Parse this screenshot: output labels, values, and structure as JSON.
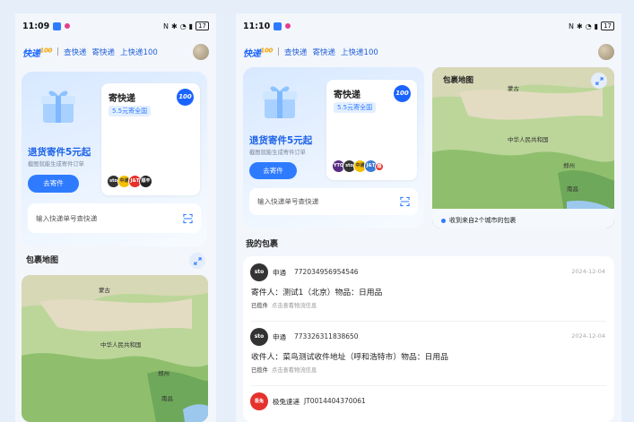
{
  "status": {
    "time_left": "11:09",
    "time_right": "11:10",
    "battery": "17"
  },
  "app": {
    "logo": "快递",
    "logo_num": "100",
    "nav": [
      "查快递",
      "寄快递",
      "上快递100"
    ]
  },
  "promo": {
    "title": "退货寄件5元起",
    "subtitle": "截图就能生成寄件订单",
    "button": "去寄件"
  },
  "ship": {
    "title": "寄快递",
    "price": "5.5元寄全国",
    "badge": "100"
  },
  "carriers_left": [
    "sto",
    "中通",
    "J&T",
    "顺丰"
  ],
  "carriers_right": [
    "YTO",
    "sto",
    "中通",
    "J&T",
    "顺"
  ],
  "search": {
    "placeholder": "输入快递单号查快递"
  },
  "map": {
    "title": "包裹地图",
    "labels": [
      "蒙古",
      "中华人民共和国",
      "郑州",
      "南昌"
    ],
    "tag": "收到来自2个城市的包裹"
  },
  "my_packages": {
    "title": "我的包裹",
    "items": [
      {
        "logo": "sto",
        "carrier": "申通",
        "num": "772034956954546",
        "date": "2024-12-04",
        "desc": "寄件人：测试1（北京）物品：日用品",
        "status": "已揽件",
        "hint": "点击查看物流信息"
      },
      {
        "logo": "sto",
        "carrier": "申通",
        "num": "773326311838650",
        "date": "2024-12-04",
        "desc": "收件人：菜鸟测试收件地址（呼和浩特市）物品：日用品",
        "status": "已揽件",
        "hint": "点击查看物流信息"
      },
      {
        "logo": "极兔",
        "carrier": "极兔速递",
        "num": "JT0014404370061",
        "date": "",
        "desc": "",
        "status": "",
        "hint": ""
      }
    ]
  },
  "colors": {
    "accent": "#2f7bff",
    "brand": "#1a66ff"
  }
}
